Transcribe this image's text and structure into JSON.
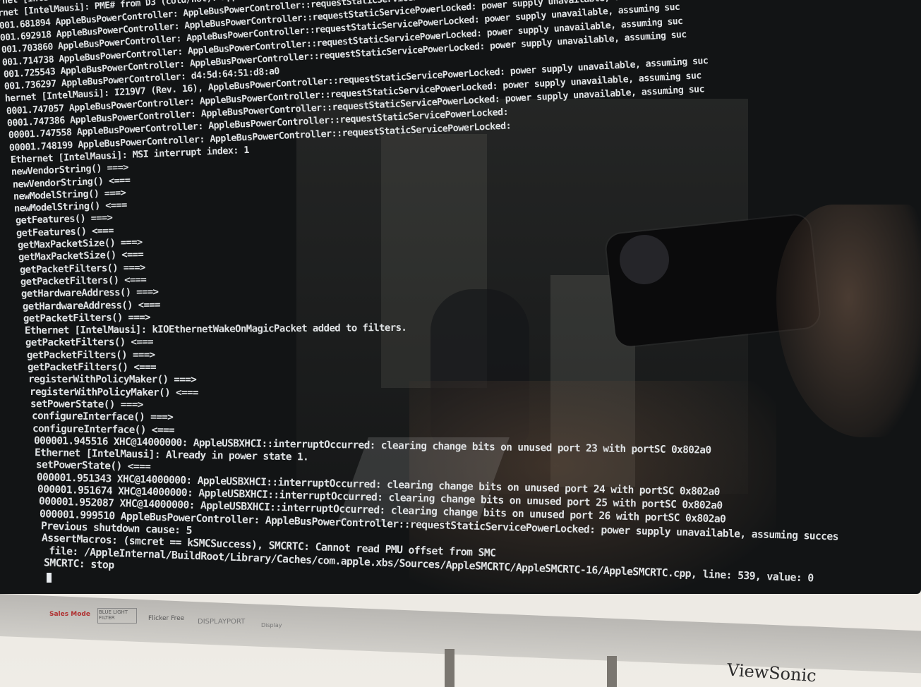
{
  "log_lines": [
    "rnet [IntelMausi]: PME# from D3 (cold/hot)",
    "rnet [IntelMausi]: PME# from D3 (cold/hot): AppleBusPowerController::requestStaticServicePowerLocked: power supply unavailable, assuming suc",
    "001.681894 AppleBusPowerController: AppleBusPowerController::requestStaticServicePowerLocked: power supply unavailable, assuming suc",
    "001.692918 AppleBusPowerController: AppleBusPowerController::requestStaticServicePowerLocked: power supply unavailable, assuming suc",
    "001.703860 AppleBusPowerController: AppleBusPowerController::requestStaticServicePowerLocked: power supply unavailable, assuming suc",
    "001.714738 AppleBusPowerController: AppleBusPowerController::requestStaticServicePowerLocked: power supply unavailable, assuming suc",
    "001.725543 AppleBusPowerController: AppleBusPowerController::requestStaticServicePowerLocked: power supply unavailable, assuming suc",
    "001.736297 AppleBusPowerController: d4:5d:64:51:d8:a0",
    "hernet [IntelMausi]: I219V7 (Rev. 16), AppleBusPowerController::requestStaticServicePowerLocked: power supply unavailable, assuming suc",
    "0001.747057 AppleBusPowerController: AppleBusPowerController::requestStaticServicePowerLocked: power supply unavailable, assuming suc",
    "0001.747386 AppleBusPowerController: AppleBusPowerController::requestStaticServicePowerLocked: power supply unavailable, assuming suc",
    "00001.747558 AppleBusPowerController: AppleBusPowerController::requestStaticServicePowerLocked:",
    "00001.748199 AppleBusPowerController: AppleBusPowerController::requestStaticServicePowerLocked:",
    "Ethernet [IntelMausi]: MSI interrupt index: 1",
    "newVendorString() ===>",
    "newVendorString() <===",
    "newModelString() ===>",
    "newModelString() <===",
    "getFeatures() ===>",
    "getFeatures() <===",
    "getMaxPacketSize() ===>",
    "getMaxPacketSize() <===",
    "getPacketFilters() ===>",
    "getPacketFilters() <===",
    "getHardwareAddress() ===>",
    "getHardwareAddress() <===",
    "getPacketFilters() ===>",
    "Ethernet [IntelMausi]: kIOEthernetWakeOnMagicPacket added to filters.",
    "getPacketFilters() <===",
    "getPacketFilters() ===>",
    "getPacketFilters() <===",
    "registerWithPolicyMaker() ===>",
    "registerWithPolicyMaker() <===",
    "setPowerState() ===>",
    "configureInterface() ===>",
    "configureInterface() <===",
    "000001.945516 XHC@14000000: AppleUSBXHCI::interruptOccurred: clearing change bits on unused port 23 with portSC 0x802a0",
    "Ethernet [IntelMausi]: Already in power state 1.",
    "setPowerState() <===",
    "000001.951343 XHC@14000000: AppleUSBXHCI::interruptOccurred: clearing change bits on unused port 24 with portSC 0x802a0",
    "000001.951674 XHC@14000000: AppleUSBXHCI::interruptOccurred: clearing change bits on unused port 25 with portSC 0x802a0",
    "000001.952087 XHC@14000000: AppleUSBXHCI::interruptOccurred: clearing change bits on unused port 26 with portSC 0x802a0",
    "000001.999510 AppleBusPowerController: AppleBusPowerController::requestStaticServicePowerLocked: power supply unavailable, assuming succes",
    "Previous shutdown cause: 5",
    "AssertMacros: (smcret == kSMCSuccess), SMCRTC: Cannot read PMU offset from SMC",
    " file: /AppleInternal/BuildRoot/Library/Caches/com.apple.xbs/Sources/AppleSMCRTC/AppleSMCRTC-16/AppleSMCRTC.cpp, line: 539, value: 0",
    "SMCRTC: stop"
  ],
  "bezel": {
    "sales_mode": "Sales Mode",
    "blue_light": "BLUE LIGHT FILTER",
    "flicker": "Flicker Free",
    "displayport": "DISPLAYPORT",
    "misc": "Display"
  },
  "brand": "ViewSonic"
}
